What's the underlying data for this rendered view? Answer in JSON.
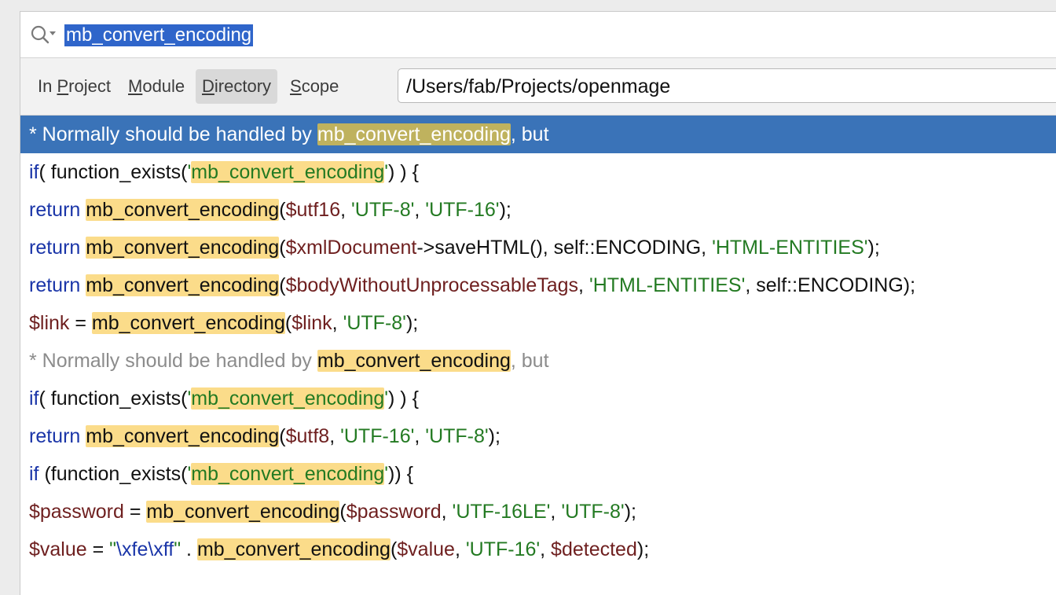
{
  "search": {
    "query": "mb_convert_encoding"
  },
  "scope_tabs": [
    {
      "label_pre": "In ",
      "mnemonic": "P",
      "label_post": "roject",
      "selected": false
    },
    {
      "label_pre": "",
      "mnemonic": "M",
      "label_post": "odule",
      "selected": false
    },
    {
      "label_pre": "",
      "mnemonic": "D",
      "label_post": "irectory",
      "selected": true
    },
    {
      "label_pre": "",
      "mnemonic": "S",
      "label_post": "cope",
      "selected": false
    }
  ],
  "directory_path": "/Users/fab/Projects/openmage",
  "colors": {
    "selection": "#3a73b8",
    "match_highlight": "#fbdc8a",
    "keyword": "#1a35a8",
    "string": "#237a22",
    "variable": "#6e1f1f",
    "comment": "#8c8c8c"
  },
  "results": [
    {
      "selected": true,
      "tokens": [
        {
          "t": "* Normally should be handled by ",
          "c": "comment"
        },
        {
          "t": "mb_convert_encoding",
          "c": "hl"
        },
        {
          "t": ", but",
          "c": "comment"
        }
      ]
    },
    {
      "tokens": [
        {
          "t": "if",
          "c": "kw"
        },
        {
          "t": "( function_exists(",
          "c": ""
        },
        {
          "t": "'",
          "c": "str"
        },
        {
          "t": "mb_convert_encoding",
          "c": "hl str"
        },
        {
          "t": "'",
          "c": "str"
        },
        {
          "t": ") ) {",
          "c": ""
        }
      ]
    },
    {
      "tokens": [
        {
          "t": "return ",
          "c": "kw"
        },
        {
          "t": "mb_convert_encoding",
          "c": "hl"
        },
        {
          "t": "(",
          "c": ""
        },
        {
          "t": "$utf16",
          "c": "var"
        },
        {
          "t": ", ",
          "c": ""
        },
        {
          "t": "'UTF-8'",
          "c": "str"
        },
        {
          "t": ", ",
          "c": ""
        },
        {
          "t": "'UTF-16'",
          "c": "str"
        },
        {
          "t": ");",
          "c": ""
        }
      ]
    },
    {
      "tokens": [
        {
          "t": "return ",
          "c": "kw"
        },
        {
          "t": "mb_convert_encoding",
          "c": "hl"
        },
        {
          "t": "(",
          "c": ""
        },
        {
          "t": "$xmlDocument",
          "c": "var"
        },
        {
          "t": "->saveHTML(), self::ENCODING, ",
          "c": ""
        },
        {
          "t": "'HTML-ENTITIES'",
          "c": "str"
        },
        {
          "t": ");",
          "c": ""
        }
      ]
    },
    {
      "tokens": [
        {
          "t": "return ",
          "c": "kw"
        },
        {
          "t": "mb_convert_encoding",
          "c": "hl"
        },
        {
          "t": "(",
          "c": ""
        },
        {
          "t": "$bodyWithoutUnprocessableTags",
          "c": "var"
        },
        {
          "t": ", ",
          "c": ""
        },
        {
          "t": "'HTML-ENTITIES'",
          "c": "str"
        },
        {
          "t": ", self::ENCODING);",
          "c": ""
        }
      ]
    },
    {
      "tokens": [
        {
          "t": "$link",
          "c": "var"
        },
        {
          "t": " = ",
          "c": ""
        },
        {
          "t": "mb_convert_encoding",
          "c": "hl"
        },
        {
          "t": "(",
          "c": ""
        },
        {
          "t": "$link",
          "c": "var"
        },
        {
          "t": ", ",
          "c": ""
        },
        {
          "t": "'UTF-8'",
          "c": "str"
        },
        {
          "t": ");",
          "c": ""
        }
      ]
    },
    {
      "tokens": [
        {
          "t": "* Normally should be handled by ",
          "c": "comment"
        },
        {
          "t": "mb_convert_encoding",
          "c": "hl"
        },
        {
          "t": ", but",
          "c": "comment"
        }
      ]
    },
    {
      "tokens": [
        {
          "t": "if",
          "c": "kw"
        },
        {
          "t": "( function_exists(",
          "c": ""
        },
        {
          "t": "'",
          "c": "str"
        },
        {
          "t": "mb_convert_encoding",
          "c": "hl str"
        },
        {
          "t": "'",
          "c": "str"
        },
        {
          "t": ") ) {",
          "c": ""
        }
      ]
    },
    {
      "tokens": [
        {
          "t": "return ",
          "c": "kw"
        },
        {
          "t": "mb_convert_encoding",
          "c": "hl"
        },
        {
          "t": "(",
          "c": ""
        },
        {
          "t": "$utf8",
          "c": "var"
        },
        {
          "t": ", ",
          "c": ""
        },
        {
          "t": "'UTF-16'",
          "c": "str"
        },
        {
          "t": ", ",
          "c": ""
        },
        {
          "t": "'UTF-8'",
          "c": "str"
        },
        {
          "t": ");",
          "c": ""
        }
      ]
    },
    {
      "tokens": [
        {
          "t": "if ",
          "c": "kw"
        },
        {
          "t": "(function_exists(",
          "c": ""
        },
        {
          "t": "'",
          "c": "str"
        },
        {
          "t": "mb_convert_encoding",
          "c": "hl str"
        },
        {
          "t": "'",
          "c": "str"
        },
        {
          "t": ")) {",
          "c": ""
        }
      ]
    },
    {
      "tokens": [
        {
          "t": "$password",
          "c": "var"
        },
        {
          "t": " = ",
          "c": ""
        },
        {
          "t": "mb_convert_encoding",
          "c": "hl"
        },
        {
          "t": "(",
          "c": ""
        },
        {
          "t": "$password",
          "c": "var"
        },
        {
          "t": ", ",
          "c": ""
        },
        {
          "t": "'UTF-16LE'",
          "c": "str"
        },
        {
          "t": ", ",
          "c": ""
        },
        {
          "t": "'UTF-8'",
          "c": "str"
        },
        {
          "t": ");",
          "c": ""
        }
      ]
    },
    {
      "tokens": [
        {
          "t": "$value",
          "c": "var"
        },
        {
          "t": " = ",
          "c": ""
        },
        {
          "t": "\"",
          "c": "str"
        },
        {
          "t": "\\xfe\\xff",
          "c": "kw"
        },
        {
          "t": "\"",
          "c": "str"
        },
        {
          "t": " . ",
          "c": ""
        },
        {
          "t": "mb_convert_encoding",
          "c": "hl"
        },
        {
          "t": "(",
          "c": ""
        },
        {
          "t": "$value",
          "c": "var"
        },
        {
          "t": ", ",
          "c": ""
        },
        {
          "t": "'UTF-16'",
          "c": "str"
        },
        {
          "t": ", ",
          "c": ""
        },
        {
          "t": "$detected",
          "c": "var"
        },
        {
          "t": ");",
          "c": ""
        }
      ]
    }
  ]
}
